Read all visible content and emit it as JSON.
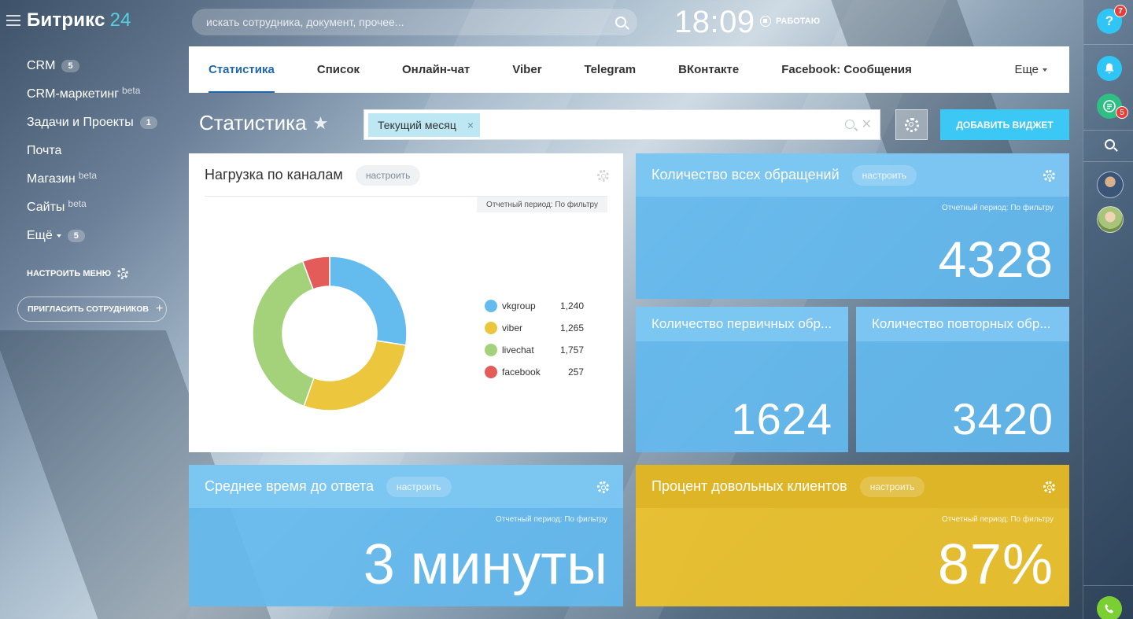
{
  "logo": {
    "name": "Битрикс",
    "num": "24"
  },
  "sidebar": {
    "items": [
      {
        "label": "CRM",
        "sup": "",
        "badge": "5"
      },
      {
        "label": "CRM-маркетинг",
        "sup": "beta",
        "badge": ""
      },
      {
        "label": "Задачи и Проекты",
        "sup": "",
        "badge": "1"
      },
      {
        "label": "Почта",
        "sup": "",
        "badge": ""
      },
      {
        "label": "Магазин",
        "sup": "beta",
        "badge": ""
      },
      {
        "label": "Сайты",
        "sup": "beta",
        "badge": ""
      },
      {
        "label": "Ещё",
        "sup": "",
        "badge": "5"
      }
    ],
    "config_label": "НАСТРОИТЬ МЕНЮ",
    "invite_label": "ПРИГЛАСИТЬ СОТРУДНИКОВ",
    "invite_plus": "+"
  },
  "header": {
    "search_placeholder": "искать сотрудника, документ, прочее...",
    "clock": "18:09",
    "status": "РАБОТАЮ"
  },
  "tabs": {
    "items": [
      "Статистика",
      "Список",
      "Онлайн-чат",
      "Viber",
      "Telegram",
      "ВКонтакте",
      "Facebook: Сообщения"
    ],
    "active": 0,
    "more": "Еще"
  },
  "toolbar": {
    "title": "Статистика",
    "star": "★",
    "filter_chip": "Текущий месяц",
    "chip_remove": "×",
    "filter_clear": "✕",
    "add_widget": "ДОБАВИТЬ ВИДЖЕТ"
  },
  "widgets": {
    "channels": {
      "title": "Нагрузка по каналам",
      "configure": "настроить",
      "period": "Отчетный период: По фильтру"
    },
    "total": {
      "title": "Количество всех обращений",
      "configure": "настроить",
      "period": "Отчетный период: По фильтру",
      "value": "4328"
    },
    "primary": {
      "title": "Количество первичных обр...",
      "value": "1624"
    },
    "repeat": {
      "title": "Количество повторных обр...",
      "value": "3420"
    },
    "response": {
      "title": "Среднее время до ответа",
      "configure": "настроить",
      "period": "Отчетный период: По фильтру",
      "value": "3 минуты"
    },
    "satisfaction": {
      "title": "Процент довольных клиентов",
      "configure": "настроить",
      "period": "Отчетный период: По фильтру",
      "value": "87%"
    }
  },
  "chart_data": {
    "type": "pie",
    "donut": true,
    "legend_position": "right",
    "categories": [
      "vkgroup",
      "viber",
      "livechat",
      "facebook"
    ],
    "values": [
      1240,
      1265,
      1757,
      257
    ],
    "value_labels": [
      "1,240",
      "1,265",
      "1,757",
      "257"
    ],
    "colors": [
      "#64bbee",
      "#ecc63c",
      "#a3d27a",
      "#e35c5a"
    ]
  },
  "rightbar": {
    "help": "?",
    "help_badge": "7",
    "chat_badge": "5"
  },
  "colors": {
    "accent": "#2067b0",
    "add_button": "#3bc8f5",
    "widget_blue": "#64b9ee",
    "widget_yellow": "#ecc22d"
  }
}
